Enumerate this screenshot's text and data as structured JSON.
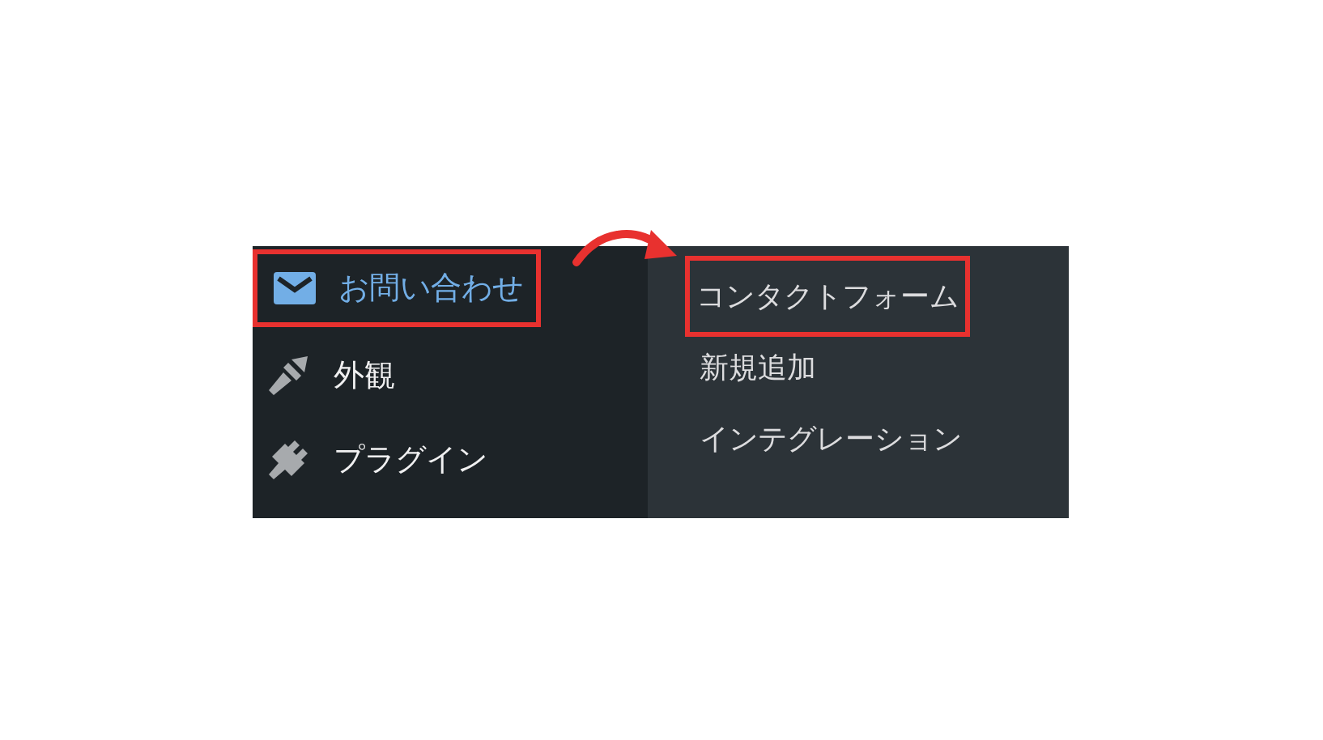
{
  "sidebar": {
    "items": [
      {
        "label": "お問い合わせ",
        "selected": true,
        "highlighted": true
      },
      {
        "label": "外観",
        "selected": false,
        "highlighted": false
      },
      {
        "label": "プラグイン",
        "selected": false,
        "highlighted": false
      }
    ]
  },
  "submenu": {
    "items": [
      {
        "label": "コンタクトフォーム",
        "highlighted": true
      },
      {
        "label": "新規追加",
        "highlighted": false
      },
      {
        "label": "インテグレーション",
        "highlighted": false
      }
    ]
  }
}
